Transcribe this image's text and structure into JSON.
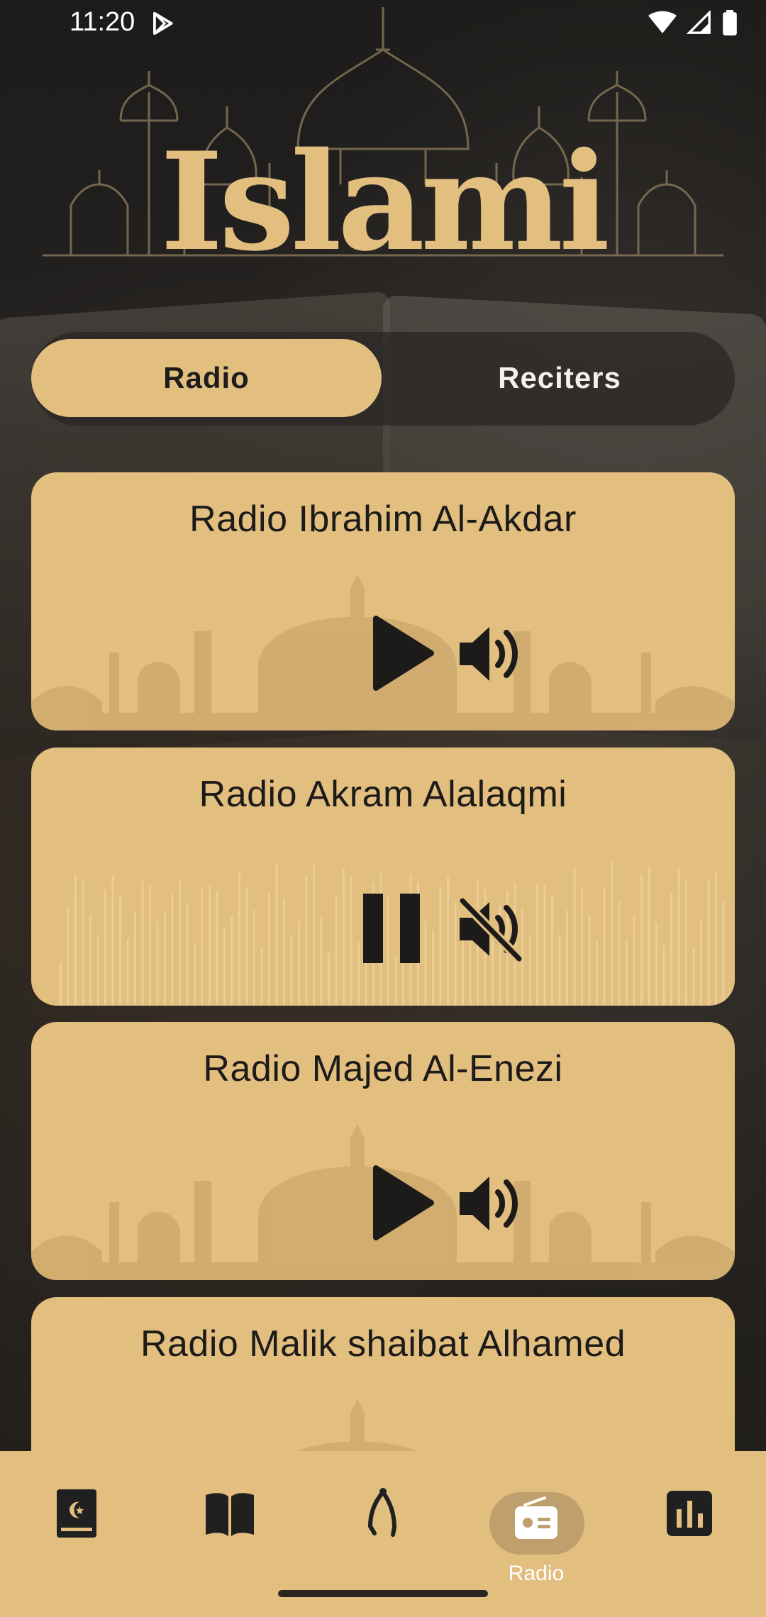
{
  "status_bar": {
    "time": "11:20"
  },
  "header": {
    "logo_text": "Islami"
  },
  "tabs": [
    {
      "label": "Radio",
      "active": true
    },
    {
      "label": "Reciters",
      "active": false
    }
  ],
  "radios": [
    {
      "title": "Radio Ibrahim Al-Akdar",
      "state": "paused",
      "muted": false
    },
    {
      "title": "Radio Akram Alalaqmi",
      "state": "playing",
      "muted": true
    },
    {
      "title": "Radio Majed Al-Enezi",
      "state": "paused",
      "muted": false
    },
    {
      "title": "Radio Malik shaibat Alhamed",
      "state": "paused",
      "muted": false
    }
  ],
  "bottom_nav": {
    "items": [
      {
        "icon": "quran-icon",
        "label": ""
      },
      {
        "icon": "hadith-book-icon",
        "label": ""
      },
      {
        "icon": "sebha-icon",
        "label": ""
      },
      {
        "icon": "radio-icon",
        "label": "Radio",
        "active": true
      },
      {
        "icon": "time-icon",
        "label": ""
      }
    ]
  },
  "colors": {
    "accent": "#E2BE7F",
    "dark": "#1E1D1B"
  }
}
